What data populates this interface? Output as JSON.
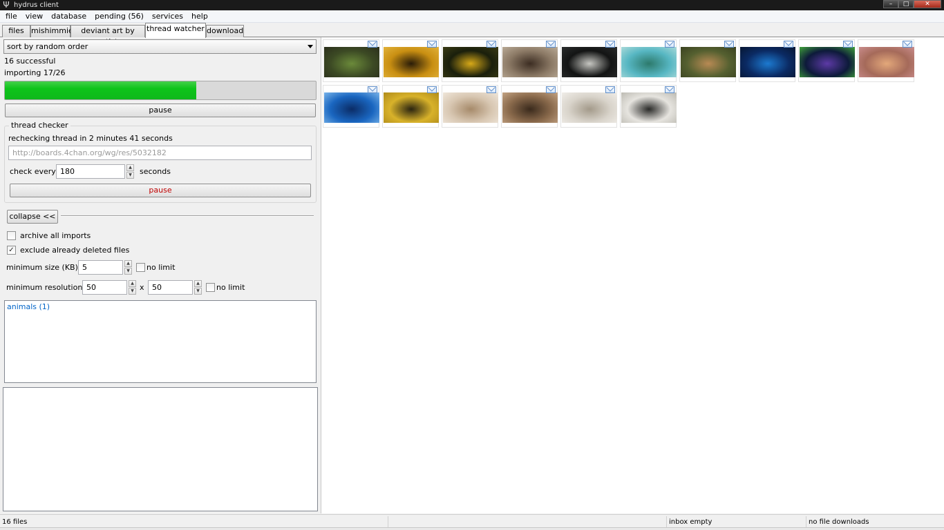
{
  "window": {
    "title": "hydrus client"
  },
  "menubar": [
    "file",
    "view",
    "database",
    "pending (56)",
    "services",
    "help"
  ],
  "tabs": [
    {
      "label": "files"
    },
    {
      "label": "mishimmie"
    },
    {
      "label": "deviant art by artist"
    },
    {
      "label": "thread watcher",
      "active": true
    },
    {
      "label": "download"
    }
  ],
  "importer": {
    "sort_value": "sort by random order",
    "successful_text": "16 successful",
    "importing_text": "importing 17/26",
    "progress_fraction": 0.615,
    "pause_label": "pause"
  },
  "thread_checker": {
    "title": "thread checker",
    "recheck_text": "rechecking thread in 2 minutes 41 seconds",
    "url_value": "http://boards.4chan.org/wg/res/5032182",
    "check_every_label": "check every",
    "check_every_value": "180",
    "seconds_label": "seconds",
    "pause_label": "pause",
    "pause_color": "#c00000"
  },
  "options": {
    "collapse_label": "collapse <<",
    "archive_label": "archive all imports",
    "archive_checked": false,
    "exclude_label": "exclude already deleted files",
    "exclude_checked": true,
    "min_size_label": "minimum size (KB): :",
    "min_size_value": "5",
    "no_limit_label": "no limit",
    "min_res_label": "minimum resolution: :",
    "min_res_w": "50",
    "min_res_x": "x",
    "min_res_h": "50"
  },
  "tags": [
    "animals (1)"
  ],
  "thumbnails": [
    {
      "subject": "kiwi bird",
      "colors": [
        "#3c4a24",
        "#6b8a3a",
        "#2b2f1c"
      ]
    },
    {
      "subject": "wasp",
      "colors": [
        "#c98f12",
        "#2a1c08",
        "#e2b23a"
      ]
    },
    {
      "subject": "wasp face",
      "colors": [
        "#1a1f0c",
        "#d7a918",
        "#3a3b14"
      ]
    },
    {
      "subject": "bear",
      "colors": [
        "#8c7a66",
        "#3c2d22",
        "#b9aa96"
      ]
    },
    {
      "subject": "beluga",
      "colors": [
        "#131414",
        "#c7c7c2",
        "#2a2c2c"
      ]
    },
    {
      "subject": "turtles",
      "colors": [
        "#57b7c3",
        "#2d7a6c",
        "#a9d9d9"
      ]
    },
    {
      "subject": "gecko",
      "colors": [
        "#556030",
        "#b88a54",
        "#3a4220"
      ]
    },
    {
      "subject": "diver",
      "colors": [
        "#0b2a63",
        "#1c7ad0",
        "#071632"
      ]
    },
    {
      "subject": "frog",
      "colors": [
        "#0d1a3a",
        "#5d3aa6",
        "#3fa23a"
      ]
    },
    {
      "subject": "fox",
      "colors": [
        "#a56a5a",
        "#e3a87a",
        "#c98c8c"
      ]
    },
    {
      "subject": "manta ray",
      "colors": [
        "#1a66c0",
        "#0b2c66",
        "#78b4ea"
      ]
    },
    {
      "subject": "moth",
      "colors": [
        "#d8b22a",
        "#2a2410",
        "#b08b1a"
      ]
    },
    {
      "subject": "fennec fox",
      "colors": [
        "#d8c7b2",
        "#a68a6a",
        "#efe6da"
      ]
    },
    {
      "subject": "bear paws",
      "colors": [
        "#8a6a4c",
        "#3a2a1c",
        "#c4a484"
      ]
    },
    {
      "subject": "meerkat",
      "colors": [
        "#d9d4cb",
        "#a39a8a",
        "#f0ede8"
      ]
    },
    {
      "subject": "polar bear",
      "colors": [
        "#e6e4df",
        "#2a2a28",
        "#bcbab2"
      ]
    }
  ],
  "statusbar": {
    "files": "16 files",
    "inbox": "inbox empty",
    "downloads": "no file downloads"
  }
}
